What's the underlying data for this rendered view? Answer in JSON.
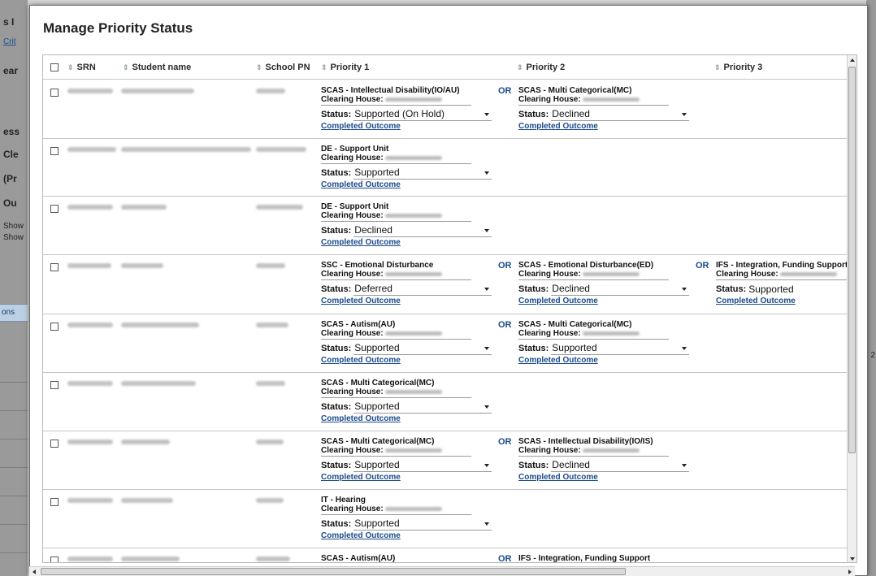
{
  "background": {
    "fragments": [
      "s I",
      "Crit",
      "ear",
      "ess",
      "Cle",
      "(Pr",
      "Ou",
      "Show",
      "Show",
      "ons",
      "2"
    ]
  },
  "modal": {
    "title": "Manage Priority Status",
    "columns": {
      "srn": "SRN",
      "student_name": "Student name",
      "school_pn": "School PN",
      "priority1": "Priority 1",
      "priority2": "Priority 2",
      "priority3": "Priority 3"
    },
    "labels": {
      "clearing_house": "Clearing House:",
      "status": "Status:",
      "completed_outcome": "Completed Outcome",
      "or": "OR"
    },
    "rows": [
      {
        "priorities": [
          {
            "title": "SCAS - Intellectual Disability(IO/AU)",
            "status": "Supported (On Hold)"
          },
          {
            "title": "SCAS - Multi Categorical(MC)",
            "status": "Declined"
          }
        ]
      },
      {
        "priorities": [
          {
            "title": "DE - Support Unit",
            "status": "Supported"
          }
        ]
      },
      {
        "priorities": [
          {
            "title": "DE - Support Unit",
            "status": "Declined"
          }
        ]
      },
      {
        "priorities": [
          {
            "title": "SSC - Emotional Disturbance",
            "status": "Deferred"
          },
          {
            "title": "SCAS - Emotional Disturbance(ED)",
            "status": "Declined"
          },
          {
            "title": "IFS - Integration, Funding Support",
            "status": "Supported"
          }
        ]
      },
      {
        "priorities": [
          {
            "title": "SCAS - Autism(AU)",
            "status": "Supported"
          },
          {
            "title": "SCAS - Multi Categorical(MC)",
            "status": "Supported"
          }
        ]
      },
      {
        "priorities": [
          {
            "title": "SCAS - Multi Categorical(MC)",
            "status": "Supported"
          }
        ]
      },
      {
        "priorities": [
          {
            "title": "SCAS - Multi Categorical(MC)",
            "status": "Supported"
          },
          {
            "title": "SCAS - Intellectual Disability(IO/IS)",
            "status": "Declined"
          }
        ]
      },
      {
        "priorities": [
          {
            "title": "IT - Hearing",
            "status": "Supported"
          }
        ]
      },
      {
        "priorities": [
          {
            "title": "SCAS - Autism(AU)"
          },
          {
            "title": "IFS - Integration, Funding Support"
          }
        ]
      }
    ]
  }
}
